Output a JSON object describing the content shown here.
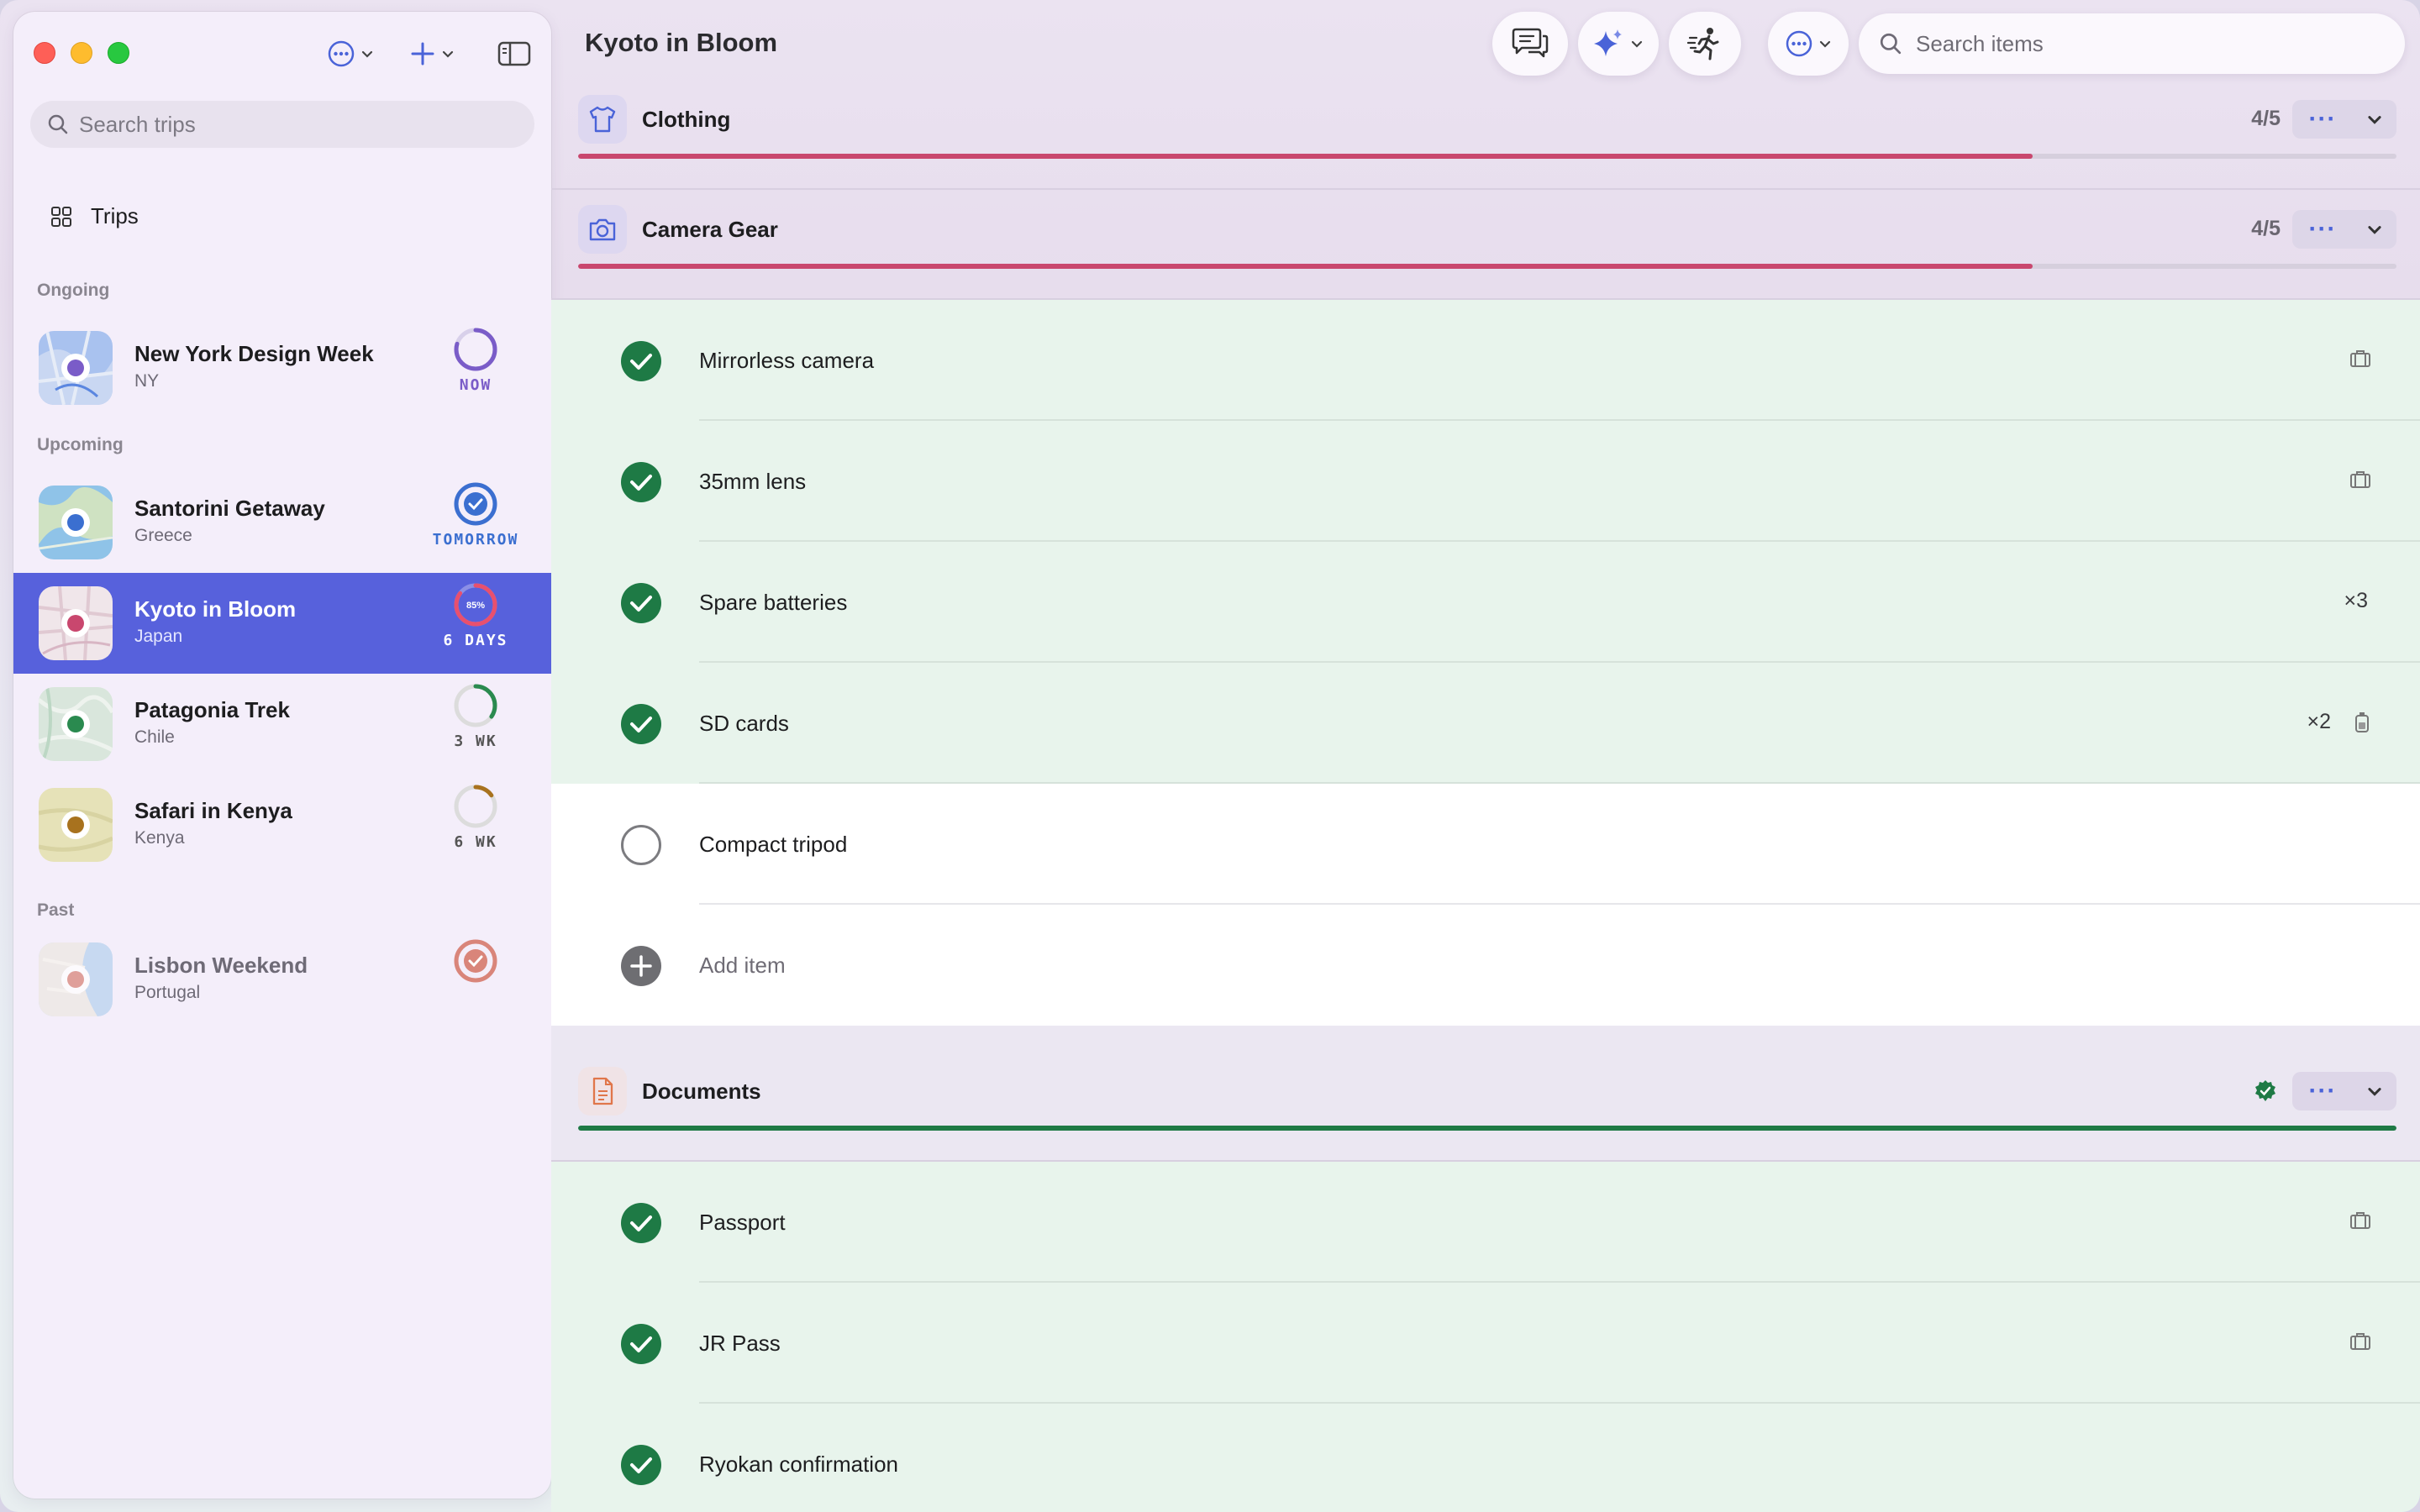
{
  "window": {
    "controls": [
      "close",
      "minimize",
      "zoom"
    ]
  },
  "sidebar": {
    "search_placeholder": "Search trips",
    "nav_trips": "Trips",
    "section_ongoing": "Ongoing",
    "section_upcoming": "Upcoming",
    "section_past": "Past",
    "trips": [
      {
        "name": "New York Design Week",
        "location": "NY",
        "status": "NOW",
        "color": "#7a5cc8",
        "progress": 0.8
      },
      {
        "name": "Santorini Getaway",
        "location": "Greece",
        "status": "TOMORROW",
        "color": "#3b6fd0",
        "progress": 1.0
      },
      {
        "name": "Kyoto in Bloom",
        "location": "Japan",
        "status": "6 DAYS",
        "progress_label": "85%",
        "color": "#c9476e",
        "progress": 0.85
      },
      {
        "name": "Patagonia Trek",
        "location": "Chile",
        "status": "3 WK",
        "color": "#2a8a4f",
        "progress": 0.35
      },
      {
        "name": "Safari in Kenya",
        "location": "Kenya",
        "status": "6 WK",
        "color": "#a8721e",
        "progress": 0.15
      },
      {
        "name": "Lisbon Weekend",
        "location": "Portugal",
        "status": "",
        "color": "#d9857a",
        "progress": 1.0
      }
    ]
  },
  "main": {
    "title": "Kyoto in Bloom",
    "search_placeholder": "Search items",
    "categories": [
      {
        "name": "Clothing",
        "count": "4/5",
        "progress": 0.8,
        "color": "#c9476e"
      },
      {
        "name": "Camera Gear",
        "count": "4/5",
        "progress": 0.8,
        "color": "#c9476e",
        "items": [
          {
            "label": "Mirrorless camera",
            "done": true,
            "meta": ""
          },
          {
            "label": "35mm lens",
            "done": true,
            "meta": ""
          },
          {
            "label": "Spare batteries",
            "done": true,
            "meta": "×3"
          },
          {
            "label": "SD cards",
            "done": true,
            "meta": "×2"
          },
          {
            "label": "Compact tripod",
            "done": false,
            "meta": ""
          }
        ],
        "add_label": "Add item"
      },
      {
        "name": "Documents",
        "count": "",
        "progress": 1.0,
        "color": "#1e7a45",
        "items": [
          {
            "label": "Passport",
            "done": true
          },
          {
            "label": "JR Pass",
            "done": true
          },
          {
            "label": "Ryokan confirmation",
            "done": true
          }
        ]
      }
    ],
    "colors": {
      "accent": "#4a63d8",
      "done_green": "#1e7a45",
      "pink": "#c9476e",
      "doc_orange": "#e0764a"
    }
  }
}
